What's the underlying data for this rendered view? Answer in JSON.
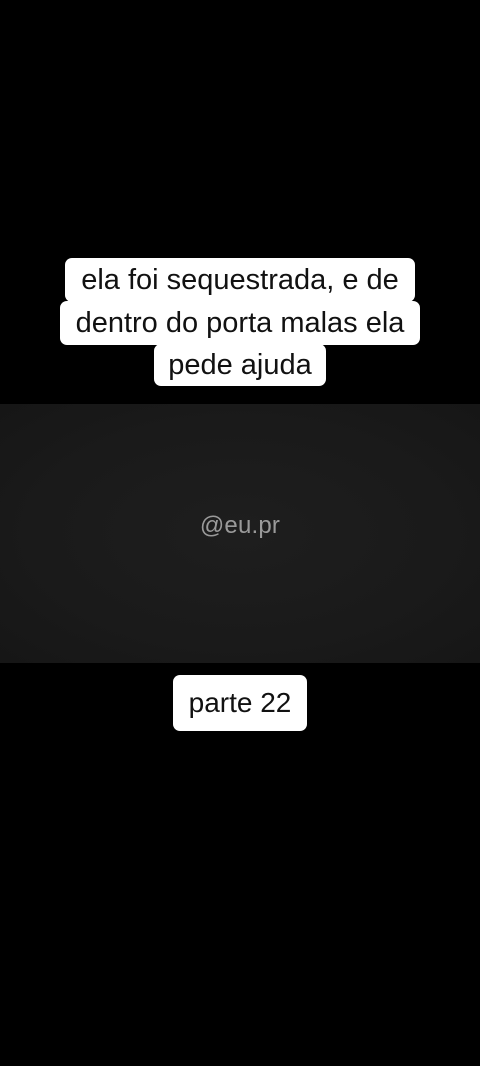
{
  "caption": {
    "lines": [
      "ela foi sequestrada, e de",
      "dentro do porta malas ela",
      "pede ajuda"
    ]
  },
  "watermark": "@eu.pr",
  "part_label": "parte 22",
  "colors": {
    "background": "#000000",
    "video_area": "#1a1a1a",
    "caption_bg": "#ffffff",
    "caption_text": "#111111",
    "watermark": "#9a9a9a"
  }
}
